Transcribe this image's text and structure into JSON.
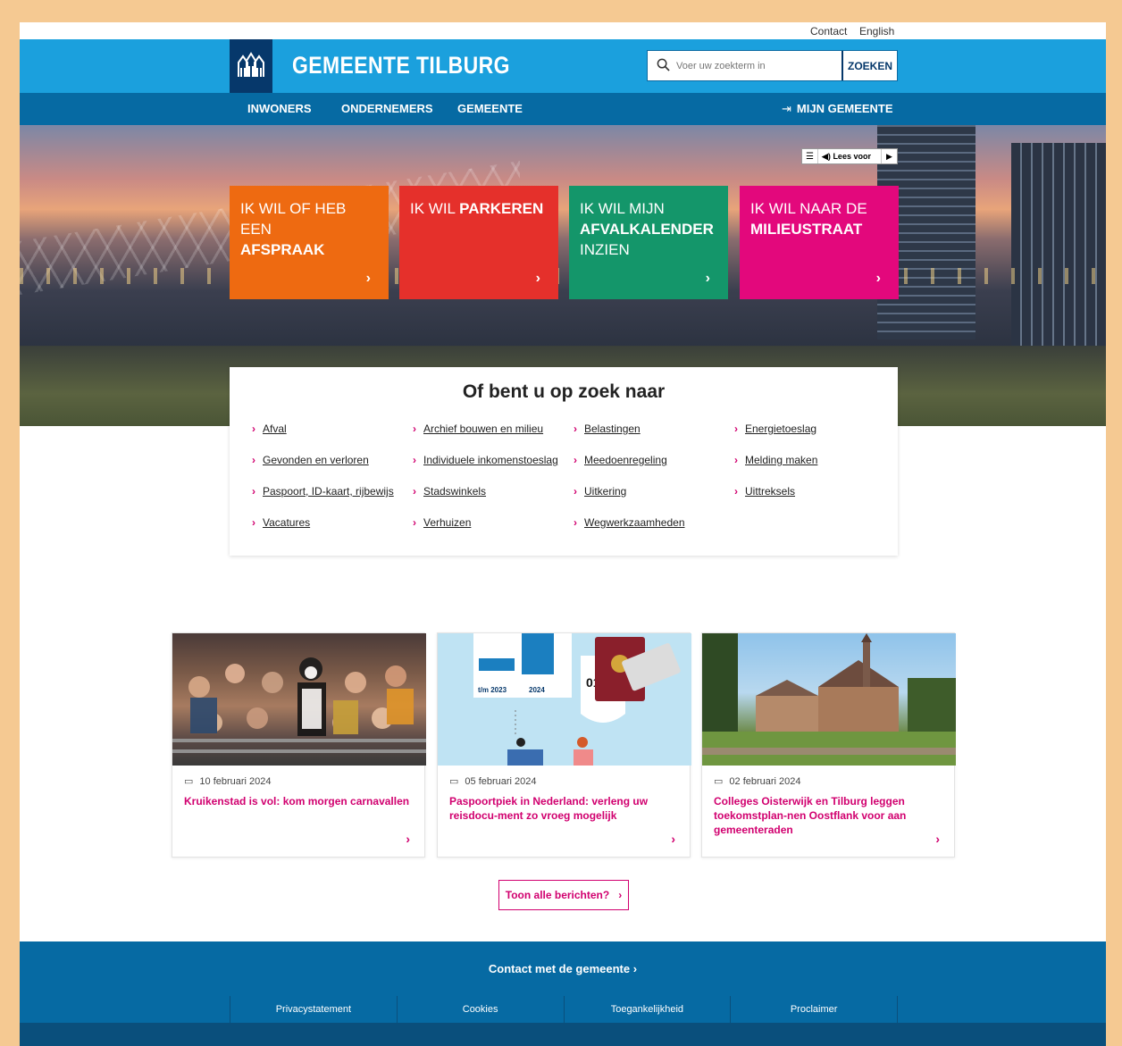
{
  "topbar": {
    "contact": "Contact",
    "english": "English"
  },
  "header": {
    "brand": "GEMEENTE TILBURG",
    "search_placeholder": "Voer uw zoekterm in",
    "search_button": "ZOEKEN"
  },
  "nav": {
    "items": [
      "INWONERS",
      "ONDERNEMERS",
      "GEMEENTE"
    ],
    "my": "MIJN GEMEENTE"
  },
  "readspeaker": {
    "label": "Lees voor"
  },
  "tiles": [
    {
      "line1": "IK WIL OF HEB EEN",
      "line2": "AFSPRAAK",
      "color": "#ee6a11"
    },
    {
      "line1": "IK WIL",
      "line2": "PARKEREN",
      "color": "#e5302b"
    },
    {
      "line1": "IK WIL MIJN",
      "line2": "AFVALKALENDER",
      "line3": "INZIEN",
      "color": "#14966a"
    },
    {
      "line1": "IK WIL NAAR DE",
      "line2": "MILIEUSTRAAT",
      "color": "#e3087c"
    }
  ],
  "quick": {
    "title": "Of bent u op zoek naar",
    "links": [
      "Afval",
      "Archief bouwen en milieu",
      "Belastingen",
      "Energietoeslag",
      "Gevonden en verloren",
      "Individuele inkomenstoeslag",
      "Meedoenregeling",
      "Melding maken",
      "Paspoort, ID-kaart, rijbewijs",
      "Stadswinkels",
      "Uitkering",
      "Uittreksels",
      "Vacatures",
      "Verhuizen",
      "Wegwerkzaamheden"
    ]
  },
  "news": [
    {
      "date": "10 februari 2024",
      "title": "Kruikenstad is vol: kom morgen carnavallen"
    },
    {
      "date": "05 februari 2024",
      "title": "Paspoortpiek in Nederland: verleng uw reisdocu-ment zo vroeg mogelijk",
      "img_labels": {
        "year1": "t/m 2023",
        "year2": "2024",
        "num": "01"
      }
    },
    {
      "date": "02 februari 2024",
      "title": "Colleges Oisterwijk en Tilburg leggen toekomstplan-nen Oostflank voor aan gemeenteraden"
    }
  ],
  "all_news": "Toon alle berichten?",
  "footer": {
    "contact": "Contact met de gemeente",
    "links": [
      "Privacystatement",
      "Cookies",
      "Toegankelijkheid",
      "Proclaimer"
    ]
  },
  "colors": {
    "brand_blue": "#1ba0dd",
    "nav_blue": "#066aa3",
    "dark_blue": "#06386b",
    "accent": "#d1006f"
  }
}
